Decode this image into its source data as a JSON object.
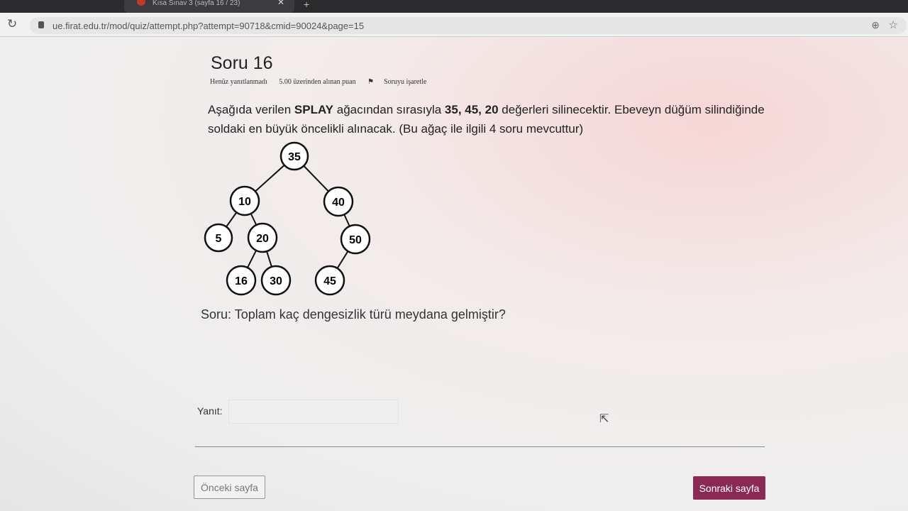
{
  "browser": {
    "tab_title": "Kısa Sınav 3 (sayfa 16 / 23)",
    "url": "ue.firat.edu.tr/mod/quiz/attempt.php?attempt=90718&cmid=90024&page=15"
  },
  "question": {
    "title": "Soru 16",
    "status": "Henüz yanıtlanmadı",
    "points": "5.00 üzerinden alınan puan",
    "flag_label": "Soruyu işaretle",
    "text_part1": "Aşağıda verilen ",
    "text_bold1": "SPLAY",
    "text_part2": " ağacından sırasıyla ",
    "text_bold2": "35, 45, 20",
    "text_part3": " değerleri silinecektir. Ebeveyn düğüm silindiğinde soldaki en büyük öncelikli alınacak. (Bu ağaç ile ilgili 4 soru mevcuttur)",
    "sub_question": "Soru: Toplam kaç dengesizlik türü meydana gelmiştir?"
  },
  "tree": {
    "nodes": [
      "35",
      "10",
      "40",
      "5",
      "20",
      "50",
      "16",
      "30",
      "45"
    ]
  },
  "answer": {
    "label": "Yanıt:",
    "value": ""
  },
  "navigation": {
    "prev_label": "Önceki sayfa",
    "next_label": "Sonraki sayfa"
  },
  "colors": {
    "next_button": "#8a2a52"
  }
}
